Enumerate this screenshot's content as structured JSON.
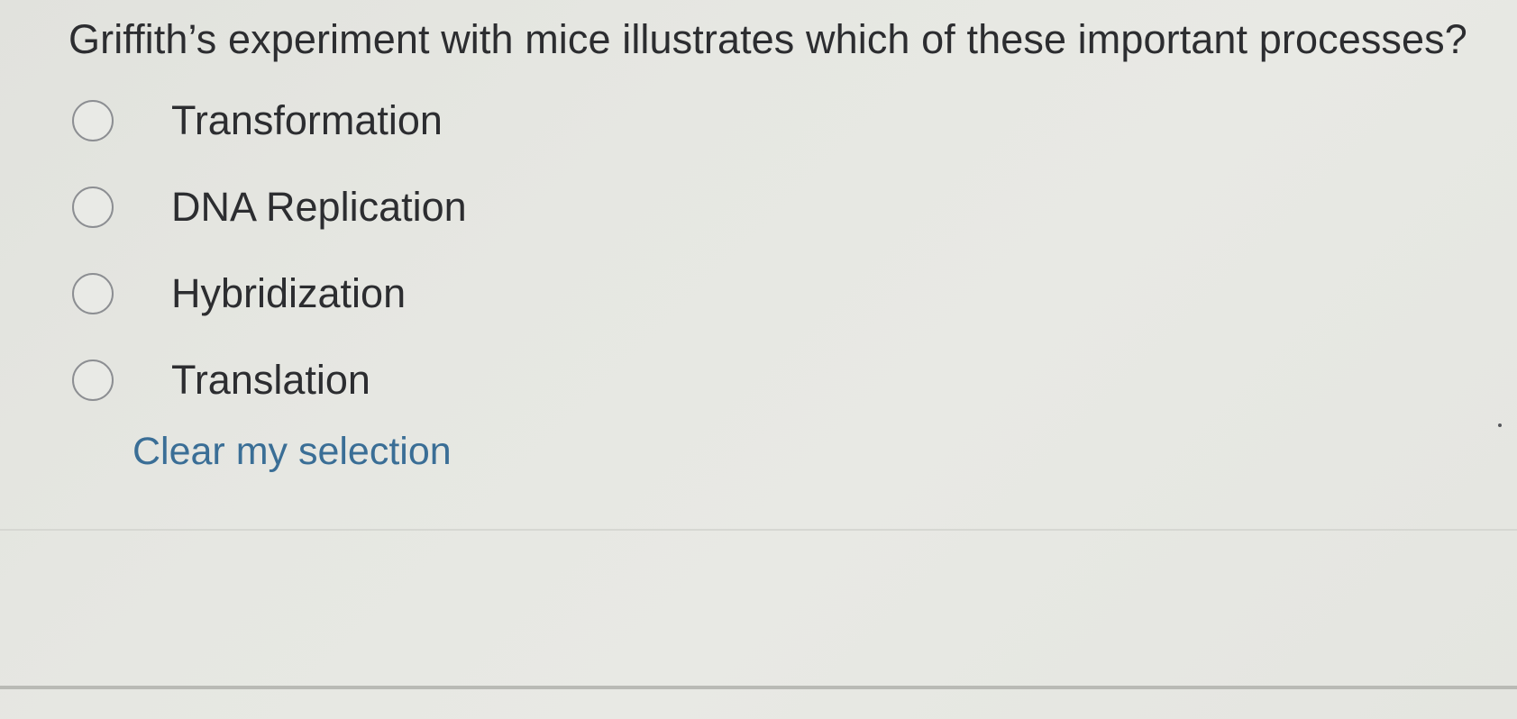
{
  "question": {
    "text": "Griffith’s experiment with mice illustrates which of these important processes?"
  },
  "options": [
    {
      "label": "Transformation",
      "selected": false
    },
    {
      "label": "DNA Replication",
      "selected": false
    },
    {
      "label": "Hybridization",
      "selected": false
    },
    {
      "label": "Translation",
      "selected": false
    }
  ],
  "clear_link": {
    "label": "Clear my selection"
  },
  "colors": {
    "text": "#2c2d30",
    "link": "#3a6e96",
    "radio_border": "#8c8e92",
    "background": "#e6e7e2"
  }
}
